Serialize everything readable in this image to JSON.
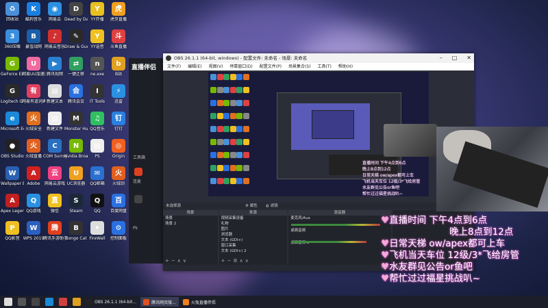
{
  "desktop_icons": [
    {
      "label": "回收站",
      "color": "#4a90d9",
      "glyph": "♻"
    },
    {
      "label": "酷狗音乐",
      "color": "#1a7fe0",
      "glyph": "K"
    },
    {
      "label": "网易云",
      "color": "#2d8fe0",
      "glyph": "◉"
    },
    {
      "label": "Dead by Daylight",
      "color": "#444",
      "glyph": "D"
    },
    {
      "label": "YY开播",
      "color": "#e8c020",
      "glyph": "Y"
    },
    {
      "label": "虎牙直播",
      "color": "#f0a020",
      "glyph": "虎"
    },
    {
      "label": "360压缩",
      "color": "#3a8ee0",
      "glyph": "3"
    },
    {
      "label": "暴雪战网",
      "color": "#1c5fa8",
      "glyph": "B"
    },
    {
      "label": "网易云音乐",
      "color": "#d03030",
      "glyph": "♪"
    },
    {
      "label": "Draw & Guess",
      "color": "#2a2a2a",
      "glyph": "✎"
    },
    {
      "label": "YY语音",
      "color": "#f0c020",
      "glyph": "Y"
    },
    {
      "label": "斗鱼直播",
      "color": "#e04040",
      "glyph": "斗"
    },
    {
      "label": "GeForce Experience",
      "color": "#76b900",
      "glyph": "G"
    },
    {
      "label": "网易UU加速器",
      "color": "#f06aa0",
      "glyph": "U"
    },
    {
      "label": "腾讯视频",
      "color": "#2a80d0",
      "glyph": "▶"
    },
    {
      "label": "一键迁移",
      "color": "#30a060",
      "glyph": "⇄"
    },
    {
      "label": "ne.exe",
      "color": "#555",
      "glyph": "n"
    },
    {
      "label": "B站",
      "color": "#e0a020",
      "glyph": "b"
    },
    {
      "label": "Logitech G HUB",
      "color": "#2a2a2a",
      "glyph": "G"
    },
    {
      "label": "网易有道词典",
      "color": "#e04060",
      "glyph": "有"
    },
    {
      "label": "新建文本",
      "color": "#ddd",
      "glyph": "▤"
    },
    {
      "label": "腾讯会议",
      "color": "#2a70e0",
      "glyph": "会"
    },
    {
      "label": "IT Tools",
      "color": "#333",
      "glyph": "I"
    },
    {
      "label": "迅雷",
      "color": "#2a90e0",
      "glyph": "⚡"
    },
    {
      "label": "Microsoft Edge",
      "color": "#1a8ad8",
      "glyph": "e"
    },
    {
      "label": "火绒安全",
      "color": "#e07020",
      "glyph": "火"
    },
    {
      "label": "新建文件",
      "color": "#eee",
      "glyph": "▤"
    },
    {
      "label": "Monster Hunter",
      "color": "#333",
      "glyph": "M"
    },
    {
      "label": "QQ音乐",
      "color": "#30c060",
      "glyph": "♫"
    },
    {
      "label": "钉钉",
      "color": "#2a80e0",
      "glyph": "钉"
    },
    {
      "label": "OBS Studio",
      "color": "#222",
      "glyph": "●"
    },
    {
      "label": "火绒直播",
      "color": "#e06020",
      "glyph": "火"
    },
    {
      "label": "COM Surrogate",
      "color": "#2a70c0",
      "glyph": "C"
    },
    {
      "label": "Nvidia Broadcast",
      "color": "#76b900",
      "glyph": "N"
    },
    {
      "label": "PS",
      "color": "#eee",
      "glyph": "▤"
    },
    {
      "label": "Origin",
      "color": "#f06020",
      "glyph": "◎"
    },
    {
      "label": "Wallpaper Engine",
      "color": "#2a60b0",
      "glyph": "W"
    },
    {
      "label": "Adobe",
      "color": "#d02020",
      "glyph": "A"
    },
    {
      "label": "网易云游戏",
      "color": "#f04080",
      "glyph": "云"
    },
    {
      "label": "UC浏览器",
      "color": "#f0a020",
      "glyph": "U"
    },
    {
      "label": "QQ邮箱",
      "color": "#2a70d0",
      "glyph": "✉"
    },
    {
      "label": "火绒剑",
      "color": "#e06020",
      "glyph": "火"
    },
    {
      "label": "Apex Legends",
      "color": "#c02020",
      "glyph": "A"
    },
    {
      "label": "QQ游戏",
      "color": "#2a90e0",
      "glyph": "Q"
    },
    {
      "label": "微信",
      "color": "#f0c020",
      "glyph": "直"
    },
    {
      "label": "Steam",
      "color": "#1b2838",
      "glyph": "S"
    },
    {
      "label": "QQ",
      "color": "#111",
      "glyph": "Q"
    },
    {
      "label": "百度网盘",
      "color": "#2a70e0",
      "glyph": "百"
    },
    {
      "label": "QQ影音",
      "color": "#f0c020",
      "glyph": "P"
    },
    {
      "label": "WPS 2019",
      "color": "#2a60c0",
      "glyph": "W"
    },
    {
      "label": "腾讯手游助手",
      "color": "#e04020",
      "glyph": "腾"
    },
    {
      "label": "Bongo Cat",
      "color": "#333",
      "glyph": "B"
    },
    {
      "label": "FireWall",
      "color": "#ddd",
      "glyph": "✦"
    },
    {
      "label": "控制面板",
      "color": "#2a70e0",
      "glyph": "⚙"
    }
  ],
  "helper_app": {
    "brand": "直播伴侣",
    "side_labels": [
      "工具箱",
      "连麦",
      "直播设置",
      "Pk"
    ]
  },
  "obs": {
    "title": "OBS 26.1.1 (64-bit, windows) - 配置文件: 未命名 - 场景: 未命名",
    "menu": [
      "文件(F)",
      "编辑(E)",
      "视图(V)",
      "停靠窗口(D)",
      "配置文件(P)",
      "场景集合(S)",
      "工具(T)",
      "帮助(H)"
    ],
    "toolbar_text": "未选择源",
    "toolbar_items": [
      "属性",
      "滤镜"
    ],
    "docks": {
      "scenes": {
        "title": "场景",
        "items": [
          "场景",
          "场景 2"
        ]
      },
      "sources": {
        "title": "来源",
        "items": [
          "视频采集设备",
          "礼物",
          "图片",
          "浏览器",
          "文本 (GDI+)",
          "窗口采集",
          "文本 (GDI+) 2"
        ]
      },
      "mixer": {
        "title": "混音器",
        "items": [
          "麦克风/Aux",
          "桌面音频",
          "桌面音频 2"
        ]
      }
    },
    "status": "LIVE: 00:00:00  REC: 00:00:00  CPU: 12.1%, 60.00 fps"
  },
  "overlay": {
    "lines": [
      "直播时间 下午4点到6点",
      "晚上8点到12点",
      "日常天梯 ow/apex都可上车",
      "飞机当天车位 12级/3*飞给房管",
      "水友群见公告or鱼吧",
      "帮忙过过福星挑战叭~"
    ]
  },
  "taskbar": {
    "apps": [
      {
        "label": "OBS 26.1.1 (64-bit...",
        "color": "#222"
      },
      {
        "label": "腾讯网页版...",
        "color": "#e05020"
      },
      {
        "label": "火兔直播伴侣",
        "color": "#f08020"
      }
    ]
  },
  "colors": {
    "overlay_glow": "#b04fb0",
    "heart": "#f6a8d8",
    "obs_bg": "#2b2e38"
  }
}
